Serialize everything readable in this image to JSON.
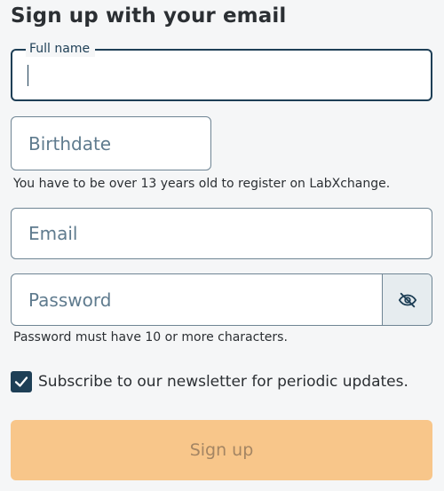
{
  "header": {
    "title": "Sign up with your email"
  },
  "form": {
    "full_name": {
      "label": "Full name",
      "value": ""
    },
    "birthdate": {
      "placeholder": "Birthdate",
      "help": "You have to be over 13 years old to register on LabXchange."
    },
    "email": {
      "placeholder": "Email"
    },
    "password": {
      "placeholder": "Password",
      "help": "Password must have 10 or more characters.",
      "toggle_icon": "eye-slash-icon"
    },
    "newsletter": {
      "checked": true,
      "label": "Subscribe to our newsletter for periodic updates."
    },
    "submit": {
      "label": "Sign up",
      "disabled": true
    }
  },
  "colors": {
    "background": "#f5f6f7",
    "primary_dark": "#1e3f56",
    "border": "#6f8594",
    "placeholder_text": "#5f7b8e",
    "button_disabled_bg": "#f8c68a",
    "button_disabled_text": "#a48563"
  }
}
